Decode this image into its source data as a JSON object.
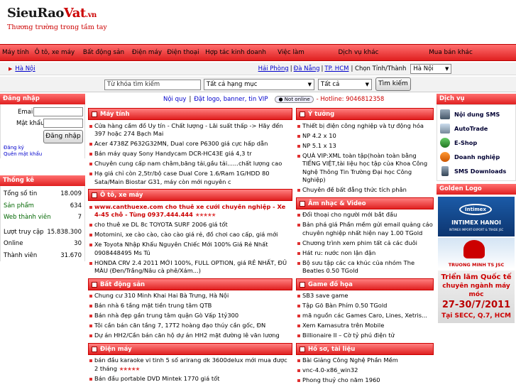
{
  "header": {
    "logo_main": "SieuRao",
    "logo_vat": "Vat",
    "logo_vn": ".vn",
    "slogan": "Thương trường trong tầm tay"
  },
  "nav": [
    "Máy tính",
    "Ô tô, xe máy",
    "Bất động sản",
    "Điện máy",
    "Điện thoại",
    "Hợp tác kinh doanh",
    "Việc làm",
    "Dịch vụ khác",
    "Mua bán khác"
  ],
  "location": {
    "current": "Hà Nội",
    "links": [
      "Hải Phòng",
      "Đà Nẵng",
      "TP. HCM"
    ],
    "choose_label": "| Chọn Tỉnh/Thành",
    "select_value": "Hà Nội"
  },
  "search": {
    "placeholder": "Từ khóa tìm kiếm",
    "category": "Tất cả hạng mục",
    "region": "Tất cả",
    "button": "Tìm kiếm"
  },
  "topline": {
    "rules": "Nội quy",
    "ad": "Đặt logo, banner, tin VIP",
    "status": "Not online",
    "hotline": "- Hotline: 9046812358"
  },
  "login": {
    "title": "Đăng nhập",
    "email_label": "Email",
    "password_label": "Mật khẩu",
    "button": "Đăng nhập",
    "register": "Đăng ký",
    "forgot": "Quên mật khẩu"
  },
  "stats": {
    "title": "Thống kê",
    "rows": [
      {
        "label": "Tổng số tin",
        "value": "18.009"
      },
      {
        "label": "Sản phẩm",
        "value": "634"
      },
      {
        "label": "Web thành viên",
        "value": "7"
      },
      {
        "label": "Lượt truy cập",
        "value": "15.838.300"
      },
      {
        "label": "Online",
        "value": "30"
      },
      {
        "label": "Thành viên",
        "value": "31.670"
      }
    ]
  },
  "left_col": [
    {
      "title": "Máy tính",
      "items": [
        "Cửa hàng cầm đồ Uy tín - Chất lượng - Lãi suất thấp -> Hãy đến 397 hoặc 274 Bạch Mai",
        "Acer 4738Z P632G32MN, Dual core P6300 giá cực hấp dẫn",
        "Bán máy quay Sony Handycam DCR-HC43E giá 4,3 tr",
        "Chuyên cung cấp nam châm,băng tải,gầu tải......chất lượng cao",
        "Hạ giá chỉ còn 2,5tr/bộ case Dual Core 1.6/Ram 1G/HDD 80 Sata/Main Biostar G31, máy còn mới nguyên c"
      ]
    },
    {
      "title": "Ô tô, xe máy",
      "items": [
        "www.canthuexe.com cho thuê xe cưới chuyên nghiệp - Xe 4-45 chỗ - Tùng 0937.444.444",
        "cho thuê xe DL 8c TOYOTA SURF 2006 giá tốt",
        "Motomini, xe cào cào, cào cào giá rẻ, đồ chơi cao cấp, giá mới",
        "Xe Toyota Nhập Khẩu Nguyên Chiếc Mới 100% Giá Rẻ Nhất 0908448495 Ms Tú",
        "HONDA CRV 2.4 2011 MỚI 100%, FULL OPTION, giá RẺ NHẤT, ĐỦ MÀU (Đen/Trắng/Nâu cà phê/Xám...)"
      ]
    },
    {
      "title": "Bất động sản",
      "items": [
        "Chung cư 310 Minh Khai Hai Bà Trưng, Hà Nội",
        "Bán nhà 6 tầng mặt tiền trung tâm QTB",
        "Bán nhà đẹp gần trung tâm quận Gò Vấp 1tỷ300",
        "Tôi cần bán căn tầng 7, 17T2 hoàng đạo thúy cần gốc, ĐN",
        "Dự án HH2/Cần bán căn hộ dự án HH2 mặt đường lê văn lương"
      ]
    },
    {
      "title": "Điện máy",
      "items": [
        "bán đầu karaoke vi tinh 5 số arirang dk 3600delux mới mua được 2 tháng",
        "Bán đầu portable DVD Mintek 1770 giá tốt"
      ]
    }
  ],
  "right_col": [
    {
      "title": "Ý tưởng",
      "items": [
        "Thiết bị điện công nghiệp và tự động hóa",
        "NP 4.2 x 10",
        "NP 5.1 x 13",
        "QUÀ VIP:XML toàn tập(hoàn toàn bằng TIẾNG VIỆT,tài liệu học tập của Khoa Công Nghệ Thông Tin Trường Đại học Công Nghiệp)",
        "Chuyên đề bất đẳng thức tích phân"
      ]
    },
    {
      "title": "Âm nhạc & Video",
      "items": [
        "Đối thoại cho người mới bắt đầu",
        "Bản phá giá Phần mềm gửi email quảng cáo chuyên nghiệp nhất hiện nay 1.00 TGold",
        "Chương trình xem phim tất cả các đuôi",
        "Hát ru: nước non lận đận",
        "Bộ sưu tập các ca khúc của nhóm The Beatles 0.50 TGold"
      ]
    },
    {
      "title": "Game đồ họa",
      "items": [
        "SB3 save game",
        "Tập Gõ Bàn Phím 0.50 TGold",
        "mã nguồn các Games Caro, Lines, Xetris...",
        "Xem Kamasutra trên Mobile",
        "Billionaire II – Cờ tỷ phú điện tử"
      ]
    },
    {
      "title": "Hồ sơ, tài liệu",
      "items": [
        "Bài Giảng Công Nghệ Phần Mềm",
        "vnc-4.0-x86_win32",
        "Phong thuỷ cho năm 1960"
      ]
    }
  ],
  "services": {
    "title": "Dịch vụ",
    "items": [
      "Nội dung SMS",
      "AutoTrade",
      "E-Shop",
      "Doanh nghiệp",
      "SMS Downloads"
    ]
  },
  "golden": {
    "title": "Golden Logo",
    "intimex_top": "Intimex",
    "intimex_name": "INTIMEX HANOI",
    "intimex_sub": "INTIMEX IMPORT-EXPORT & TRADE JSC",
    "tm_name": "TRUONG MINH TS JSC",
    "expo_line1": "Triển lãm Quốc tế",
    "expo_line2": "chuyên ngành máy móc",
    "expo_date": "27-30/7/2011",
    "expo_place": "Tại SECC, Q.7, HCM"
  }
}
